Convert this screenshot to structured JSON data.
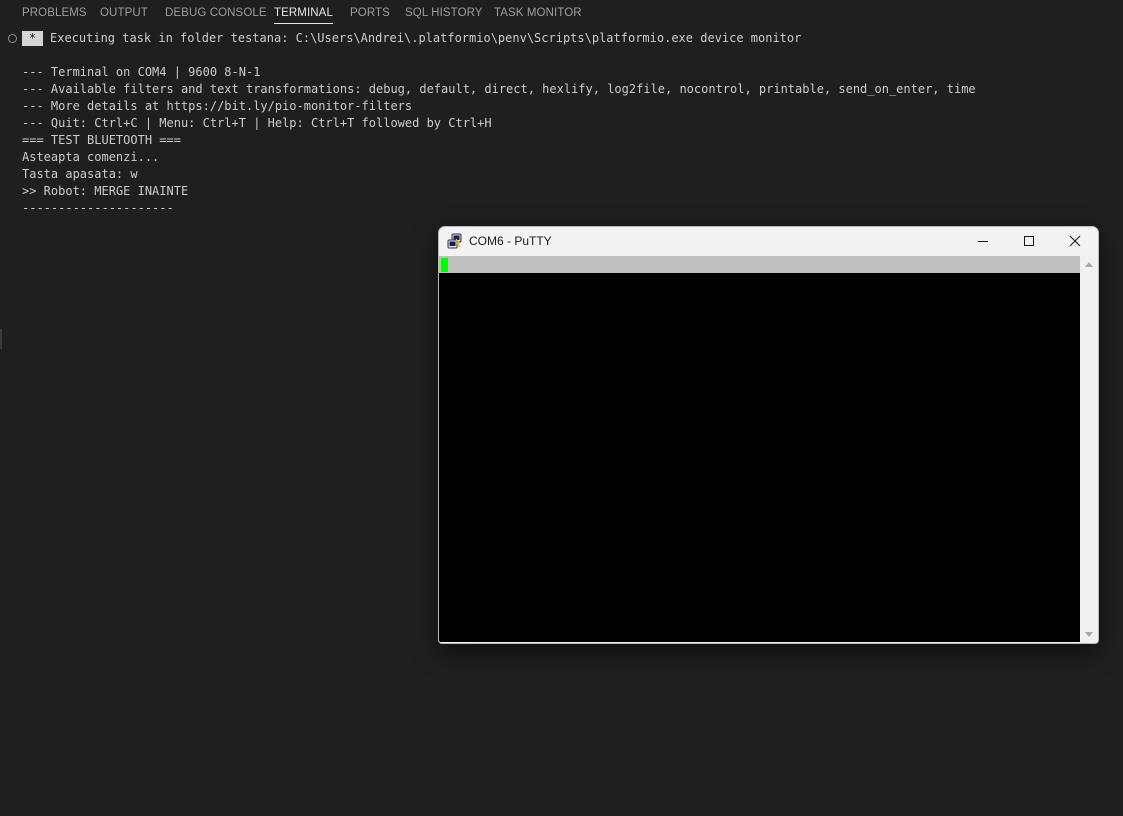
{
  "panel": {
    "tabs": [
      {
        "label": "PROBLEMS"
      },
      {
        "label": "OUTPUT"
      },
      {
        "label": "DEBUG CONSOLE"
      },
      {
        "label": "TERMINAL",
        "active": true
      },
      {
        "label": "PORTS"
      },
      {
        "label": "SQL HISTORY"
      },
      {
        "label": "TASK MONITOR"
      }
    ]
  },
  "terminal": {
    "task_badge": "*",
    "exec_text": "Executing task in folder testana: C:\\Users\\Andrei\\.platformio\\penv\\Scripts\\platformio.exe device monitor",
    "lines": [
      "--- Terminal on COM4 | 9600 8-N-1",
      "--- Available filters and text transformations: debug, default, direct, hexlify, log2file, nocontrol, printable, send_on_enter, time",
      "--- More details at https://bit.ly/pio-monitor-filters",
      "--- Quit: Ctrl+C | Menu: Ctrl+T | Help: Ctrl+T followed by Ctrl+H",
      "=== TEST BLUETOOTH ===",
      "Asteapta comenzi...",
      "Tasta apasata: w",
      ">> Robot: MERGE INAINTE",
      "---------------------"
    ]
  },
  "putty": {
    "title": "COM6 - PuTTY",
    "app_icon": "putty-icon",
    "cursor_color": "#00ff00",
    "status_bar_color": "#c0c0c0",
    "screen_bg": "#000000"
  },
  "colors": {
    "vscode_bg": "#1f1f1f",
    "terminal_text": "#cccccc",
    "tab_inactive": "#9d9d9d",
    "tab_active": "#e7e7e7"
  }
}
